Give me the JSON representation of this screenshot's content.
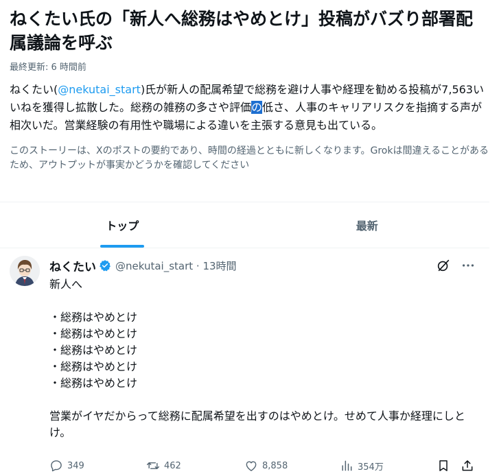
{
  "story": {
    "title": "ねくたい氏の「新人へ総務はやめとけ」投稿がバズり部署配属議論を呼ぶ",
    "updated": "最終更新: 6 時間前",
    "summary_before_mention": "ねくたい(",
    "mention": "@nekutai_start",
    "summary_after_mention": ")氏が新人の配属希望で総務を避け人事や経理を勧める投稿が7,563いいねを獲得し拡散した。総務の雑務の多さや評価",
    "summary_highlight": "の",
    "summary_rest": "低さ、人事のキャリアリスクを指摘する声が相次いだ。営業経験の有用性や職場による違いを主張する意見も出ている。",
    "disclaimer": "このストーリーは、Xのポストの要約であり、時間の経過とともに新しくなります。Grokは間違えることがあるため、アウトプットが事実かどうかを確認してください"
  },
  "tabs": [
    {
      "label": "トップ",
      "active": true
    },
    {
      "label": "最新",
      "active": false
    }
  ],
  "post": {
    "author": "ねくたい",
    "handle_time": "@nekutai_start · 13時間",
    "lines": [
      "新人へ",
      "・総務はやめとけ",
      "・総務はやめとけ",
      "・総務はやめとけ",
      "・総務はやめとけ",
      "・総務はやめとけ",
      "営業がイヤだからって総務に配属希望を出すのはやめとけ。せめて人事か経理にしとけ。"
    ],
    "stats": {
      "replies": "349",
      "reposts": "462",
      "likes": "8,858",
      "views": "354万"
    }
  },
  "colors": {
    "accent": "#1d9bf0",
    "muted": "#536471",
    "text": "#0f1419",
    "selection": "#1e6fd0"
  },
  "icons": [
    "verified-badge-icon",
    "grok-icon",
    "more-icon",
    "reply-icon",
    "repost-icon",
    "like-icon",
    "views-icon",
    "bookmark-icon",
    "share-icon"
  ]
}
